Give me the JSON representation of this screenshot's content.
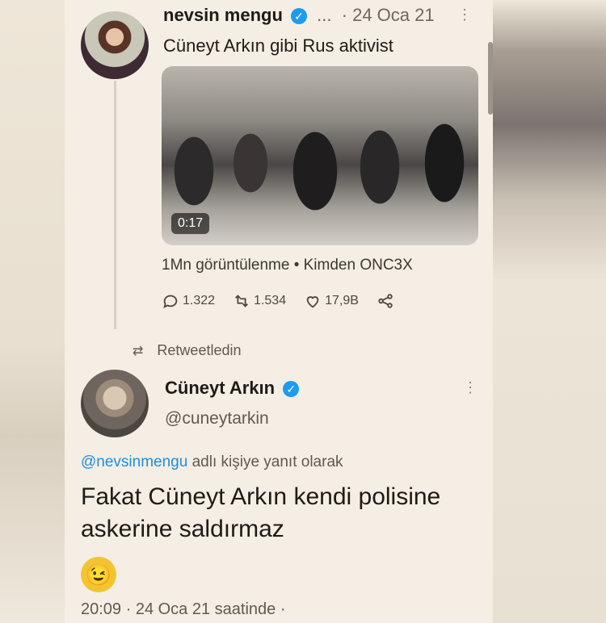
{
  "tweet1": {
    "author_name": "nevsin mengu",
    "ellipsis": "...",
    "date": "· 24 Oca 21",
    "text": "Cüneyt Arkın gibi Rus aktivist",
    "video_duration": "0:17",
    "views": "1Mn görüntülenme • Kimden ONC3X",
    "reply_count": "1.322",
    "retweet_count": "1.534",
    "like_count": "17,9B"
  },
  "retweet_label": "Retweetledin",
  "tweet2": {
    "author_name": "Cüneyt Arkın",
    "handle": "@cuneytarkin",
    "reply_mention": "@nevsinmengu",
    "reply_suffix": "adlı kişiye yanıt olarak",
    "text": "Fakat Cüneyt Arkın kendi polisine askerine saldırmaz",
    "emoji": "😉",
    "timestamp": "20:09 · 24 Oca 21 saatinde ·"
  },
  "colors": {
    "verified": "#1d9bf0",
    "mention": "#1d8fdc"
  },
  "icons": [
    "verified-badge-icon",
    "more-options-icon",
    "reply-icon",
    "retweet-icon",
    "like-icon",
    "share-icon"
  ]
}
